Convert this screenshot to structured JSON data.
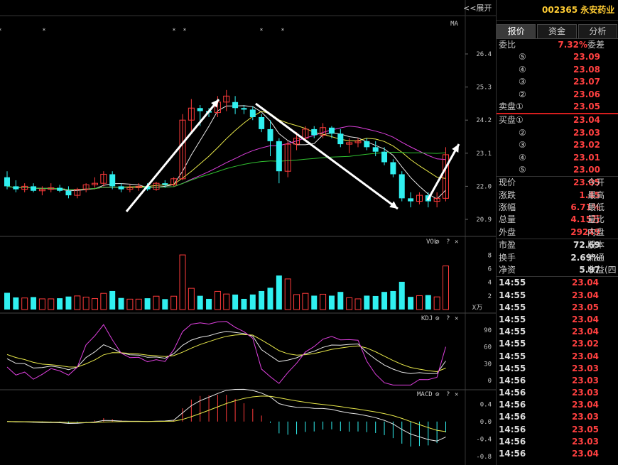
{
  "header": {
    "code_name": "002365 永安药业",
    "expand": "<<展开"
  },
  "tabs": [
    "报价",
    "资金",
    "分析"
  ],
  "quote": {
    "webi_label": "委比",
    "webi_value": "7.32%",
    "weicha_label": "委差",
    "sell_label": "卖盘①",
    "buy_label": "买盘①",
    "sell_levels": [
      {
        "circle": "⑤",
        "price": "23.09"
      },
      {
        "circle": "④",
        "price": "23.08"
      },
      {
        "circle": "③",
        "price": "23.07"
      },
      {
        "circle": "②",
        "price": "23.06"
      },
      {
        "circle": "",
        "price": "23.05"
      }
    ],
    "buy_levels": [
      {
        "circle": "",
        "price": "23.04"
      },
      {
        "circle": "②",
        "price": "23.03"
      },
      {
        "circle": "③",
        "price": "23.02"
      },
      {
        "circle": "④",
        "price": "23.01"
      },
      {
        "circle": "⑤",
        "price": "23.00"
      }
    ],
    "stats": [
      {
        "label": "现价",
        "value": "23.05",
        "right": "今开",
        "color": "red"
      },
      {
        "label": "涨跌",
        "value": "1.45",
        "right": "最高",
        "color": "red"
      },
      {
        "label": "涨幅",
        "value": "6.71%",
        "right": "最低",
        "color": "red"
      },
      {
        "label": "总量",
        "value": "4.15万",
        "right": "量比",
        "color": "red"
      },
      {
        "label": "外盘",
        "value": "29249",
        "right": "内盘",
        "color": "red"
      }
    ],
    "fundamentals": [
      {
        "label": "市盈",
        "value": "72.69",
        "right": "股本"
      },
      {
        "label": "换手",
        "value": "2.69%",
        "right": "流通"
      },
      {
        "label": "净资",
        "value": "5.97",
        "right": "收益(四"
      }
    ]
  },
  "ticks": [
    {
      "time": "14:55",
      "price": "23.04"
    },
    {
      "time": "14:55",
      "price": "23.04"
    },
    {
      "time": "14:55",
      "price": "23.05"
    },
    {
      "time": "14:55",
      "price": "23.04"
    },
    {
      "time": "14:55",
      "price": "23.04"
    },
    {
      "time": "14:55",
      "price": "23.02"
    },
    {
      "time": "14:55",
      "price": "23.04"
    },
    {
      "time": "14:55",
      "price": "23.03"
    },
    {
      "time": "14:56",
      "price": "23.03"
    },
    {
      "time": "14:56",
      "price": "23.03"
    },
    {
      "time": "14:56",
      "price": "23.04"
    },
    {
      "time": "14:56",
      "price": "23.03"
    },
    {
      "time": "14:56",
      "price": "23.05"
    },
    {
      "time": "14:56",
      "price": "23.03"
    },
    {
      "time": "14:56",
      "price": "23.04"
    }
  ],
  "chart_data": {
    "type": "candlestick",
    "main": {
      "label": "MA",
      "y_ticks": [
        "26.4",
        "25.3",
        "24.2",
        "23.1",
        "22.0",
        "20.9"
      ],
      "ylim": [
        20.9,
        26.4
      ],
      "stars": [
        "*",
        "*",
        "*",
        "*",
        "*",
        "*"
      ],
      "candles": [
        [
          22.3,
          22.5,
          21.9,
          22.0
        ],
        [
          22.0,
          22.2,
          21.8,
          21.9
        ],
        [
          21.9,
          22.1,
          21.8,
          22.0
        ],
        [
          22.0,
          22.1,
          21.8,
          21.85
        ],
        [
          21.85,
          22.0,
          21.7,
          21.9
        ],
        [
          21.9,
          22.1,
          21.8,
          21.95
        ],
        [
          21.95,
          22.05,
          21.8,
          21.85
        ],
        [
          21.85,
          22.0,
          21.6,
          21.7
        ],
        [
          21.7,
          21.95,
          21.6,
          21.9
        ],
        [
          21.9,
          22.1,
          21.8,
          22.05
        ],
        [
          22.05,
          22.3,
          21.95,
          22.1
        ],
        [
          22.1,
          22.5,
          22.0,
          22.4
        ],
        [
          22.4,
          22.5,
          21.9,
          22.0
        ],
        [
          22.0,
          22.1,
          21.8,
          21.9
        ],
        [
          21.9,
          22.05,
          21.8,
          21.95
        ],
        [
          21.95,
          22.1,
          21.85,
          22.0
        ],
        [
          22.0,
          22.1,
          21.85,
          21.9
        ],
        [
          21.9,
          22.15,
          21.85,
          22.1
        ],
        [
          22.1,
          22.2,
          21.95,
          22.05
        ],
        [
          22.05,
          22.3,
          22.0,
          22.25
        ],
        [
          22.25,
          24.4,
          22.2,
          24.2
        ],
        [
          24.2,
          24.9,
          23.8,
          24.6
        ],
        [
          24.6,
          24.7,
          24.0,
          24.5
        ],
        [
          24.5,
          24.6,
          24.3,
          24.45
        ],
        [
          24.45,
          25.0,
          24.3,
          24.8
        ],
        [
          24.8,
          25.2,
          24.5,
          25.0
        ],
        [
          24.8,
          25.0,
          24.4,
          24.6
        ],
        [
          24.6,
          24.7,
          24.4,
          24.55
        ],
        [
          24.55,
          24.65,
          24.2,
          24.3
        ],
        [
          24.3,
          24.4,
          23.8,
          23.9
        ],
        [
          23.9,
          24.2,
          23.0,
          23.5
        ],
        [
          23.5,
          23.6,
          22.1,
          22.5
        ],
        [
          22.5,
          23.5,
          22.3,
          23.4
        ],
        [
          23.4,
          23.8,
          23.2,
          23.6
        ],
        [
          23.6,
          24.0,
          23.5,
          23.9
        ],
        [
          23.9,
          24.0,
          23.6,
          23.7
        ],
        [
          23.7,
          24.1,
          23.6,
          23.95
        ],
        [
          23.95,
          24.0,
          23.6,
          23.75
        ],
        [
          23.75,
          23.9,
          23.3,
          23.4
        ],
        [
          23.4,
          23.6,
          23.1,
          23.45
        ],
        [
          23.45,
          23.6,
          23.3,
          23.5
        ],
        [
          23.5,
          23.6,
          23.2,
          23.3
        ],
        [
          23.3,
          23.5,
          23.0,
          23.15
        ],
        [
          23.15,
          23.3,
          22.7,
          22.8
        ],
        [
          22.8,
          22.9,
          22.3,
          22.4
        ],
        [
          22.4,
          22.5,
          21.5,
          21.6
        ],
        [
          21.6,
          21.8,
          21.3,
          21.5
        ],
        [
          21.5,
          21.8,
          21.4,
          21.7
        ],
        [
          21.7,
          21.8,
          21.3,
          21.5
        ],
        [
          21.5,
          21.8,
          21.3,
          21.6
        ],
        [
          21.6,
          23.3,
          21.5,
          23.05
        ]
      ]
    },
    "vol": {
      "label": "VOL",
      "y_ticks": [
        "8",
        "6",
        "4",
        "2"
      ],
      "unit": "X万",
      "ylim": [
        0,
        9.5
      ]
    },
    "kdj": {
      "label": "KDJ",
      "y_ticks": [
        "90",
        "60",
        "30",
        "0"
      ],
      "ylim": [
        -10,
        110
      ]
    },
    "macd": {
      "label": "MACD",
      "y_ticks": [
        "0.4",
        "0.0",
        "-0.4",
        "-0.8"
      ],
      "ylim": [
        -0.9,
        0.6
      ]
    }
  }
}
